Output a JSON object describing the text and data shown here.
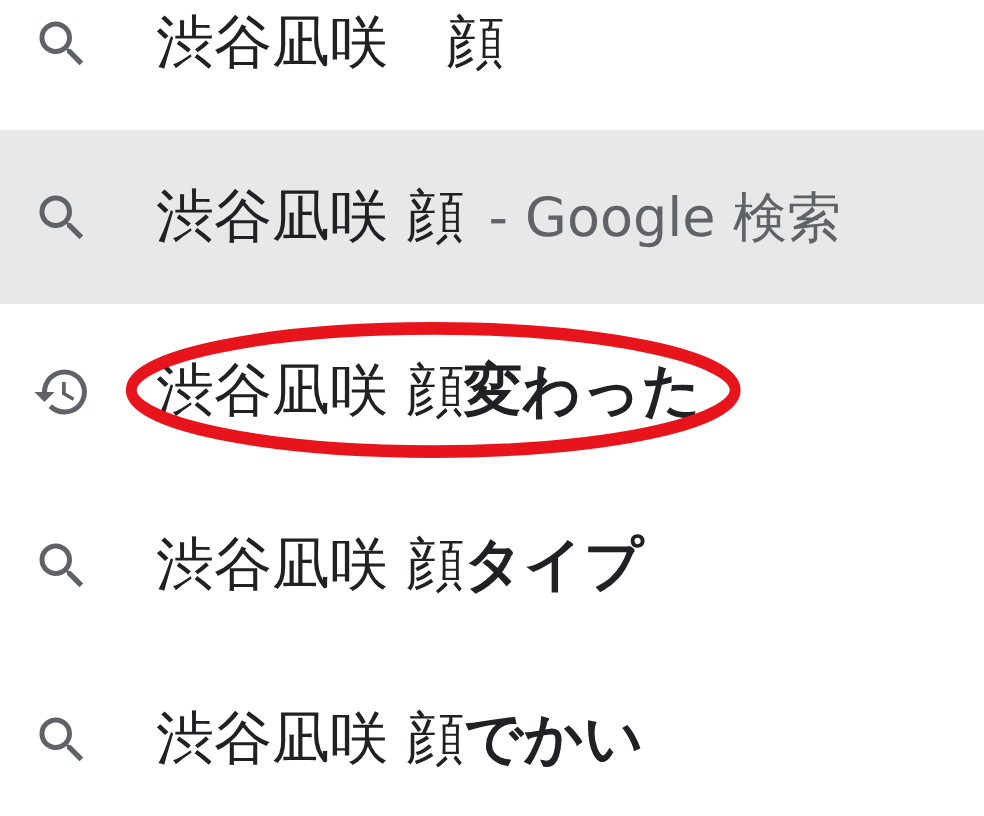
{
  "suggestions": [
    {
      "kind": "search",
      "text": "渋谷凪咲　顔",
      "selected": false,
      "circled": false
    },
    {
      "kind": "search",
      "text": "渋谷凪咲 顔",
      "source": "- Google 検索",
      "selected": true,
      "circled": false
    },
    {
      "kind": "history",
      "text": "渋谷凪咲 顔**変わった**",
      "selected": false,
      "circled": true
    },
    {
      "kind": "search",
      "text": "渋谷凪咲 顔**タイプ**",
      "selected": false,
      "circled": false
    },
    {
      "kind": "search",
      "text": "渋谷凪咲 顔**でかい**",
      "selected": false,
      "circled": false
    }
  ]
}
